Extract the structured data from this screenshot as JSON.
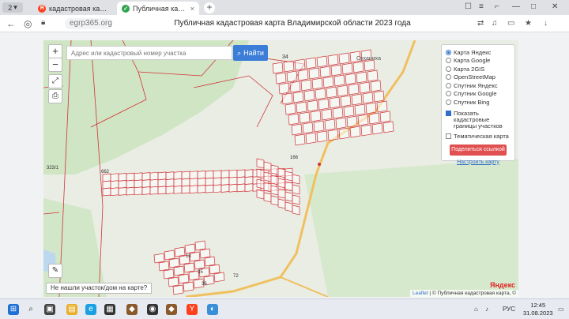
{
  "browser": {
    "tab_count": "2",
    "tabs": [
      {
        "title": "кадастровая карта влад"
      },
      {
        "title": "Публичная кадастровая"
      }
    ],
    "url": "egrp365.org",
    "page_title": "Публичная кадастровая карта Владимирской области 2023 года"
  },
  "map": {
    "search_placeholder": "Адрес или кадастровый номер участка",
    "search_button": "Найти",
    "zoom_in": "+",
    "zoom_out": "−",
    "village_label": "Суханиха",
    "parcel_labels": [
      "34",
      "323/1",
      "662",
      "166",
      "35",
      "14",
      "36",
      "72"
    ],
    "layers": {
      "options": [
        "Карта Яндекс",
        "Карта Google",
        "Карта 2GIS",
        "OpenStreetMap",
        "Спутник Яндекс",
        "Спутник Google",
        "Спутник Bing"
      ],
      "selected_index": 0,
      "show_borders": "Показать кадастровые границы участков",
      "thematic": "Тематическая карта",
      "share": "Поделиться ссылкой",
      "setup": "Настроить карту"
    },
    "not_found": "Не нашли участок/дом на карте?",
    "attribution_leaflet": "Leaflet",
    "attribution_text": "| © Публичная кадастровая карта, ©",
    "yandex": "Яндекс"
  },
  "taskbar": {
    "lang": "РУС",
    "time": "12:45",
    "date": "31.08.2023"
  },
  "colors": {
    "accent": "#3b7dd8",
    "parcel": "#d0343a",
    "forest": "#cfe5c3",
    "road": "#f0c060"
  }
}
